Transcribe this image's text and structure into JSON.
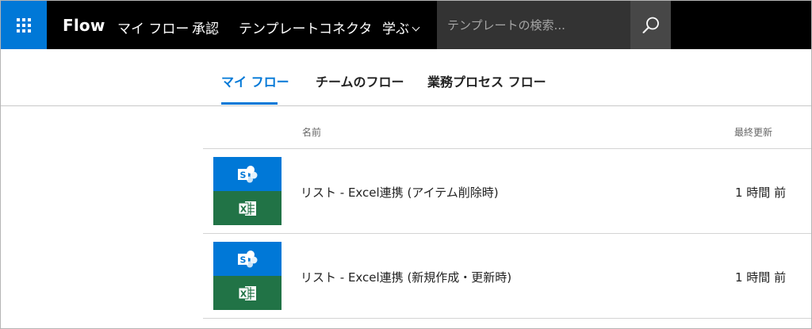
{
  "topbar": {
    "brand": "Flow",
    "nav": [
      {
        "label": "マイ フロー"
      },
      {
        "label": "承認"
      },
      {
        "label": "テンプレート"
      },
      {
        "label": "コネクタ"
      },
      {
        "label": "学ぶ"
      }
    ],
    "search": {
      "placeholder": "テンプレートの検索..."
    }
  },
  "tabs": [
    {
      "label": "マイ フロー",
      "active": true
    },
    {
      "label": "チームのフロー",
      "active": false
    },
    {
      "label": "業務プロセス フロー",
      "active": false
    }
  ],
  "list": {
    "columns": {
      "name": "名前",
      "modified": "最終更新"
    },
    "rows": [
      {
        "title": "リスト - Excel連携 (アイテム削除時)",
        "modified": "1 時間 前",
        "icons": [
          "sharepoint-icon",
          "excel-icon"
        ]
      },
      {
        "title": "リスト - Excel連携 (新規作成・更新時)",
        "modified": "1 時間 前",
        "icons": [
          "sharepoint-icon",
          "excel-icon"
        ]
      }
    ]
  },
  "colors": {
    "accent": "#0078d7",
    "topbar": "#000000",
    "search_bg": "#333333",
    "sharepoint": "#0078d7",
    "excel": "#217346"
  }
}
